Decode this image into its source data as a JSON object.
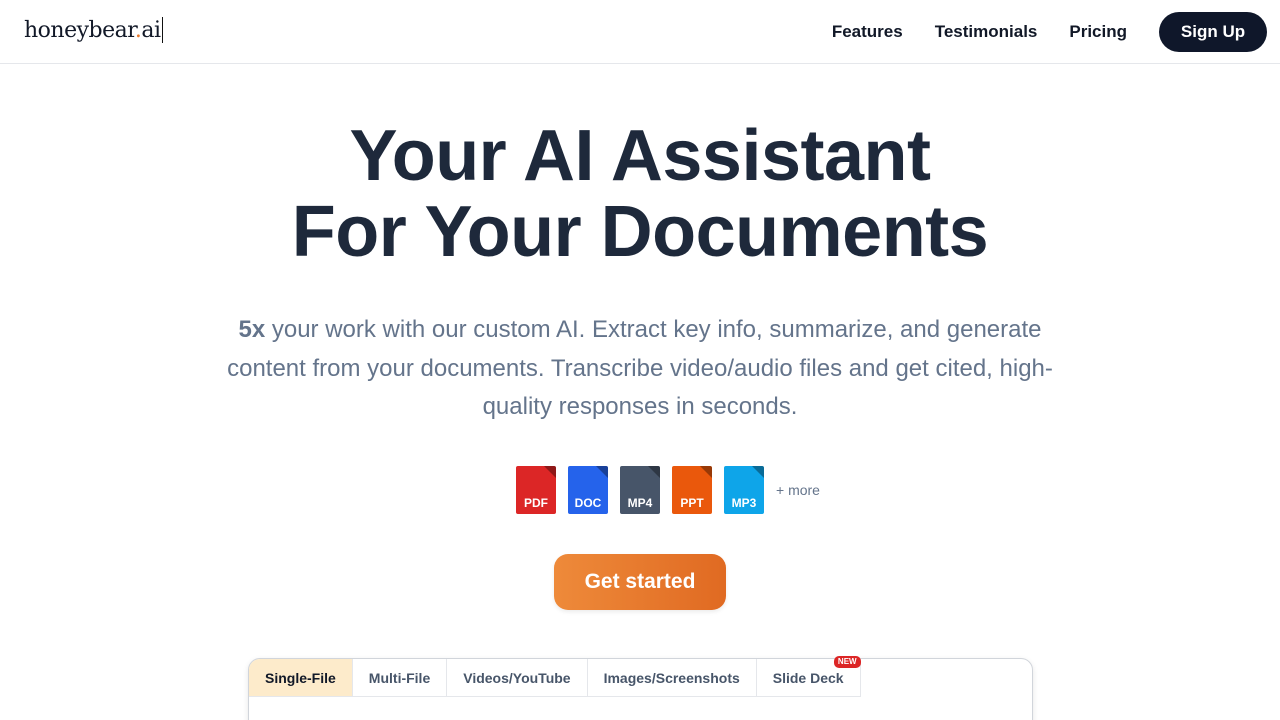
{
  "header": {
    "logo": {
      "name": "honeybear",
      "dot": ".",
      "suffix": "ai"
    },
    "nav": [
      "Features",
      "Testimonials",
      "Pricing"
    ],
    "signup_label": "Sign Up"
  },
  "hero": {
    "title_line1": "Your AI Assistant",
    "title_line2": "For Your Documents",
    "subtitle_bold": "5x",
    "subtitle_rest": " your work with our custom AI. Extract key info, summarize, and generate content from your documents. Transcribe video/audio files and get cited, high-quality responses in seconds.",
    "file_types": [
      {
        "label": "PDF",
        "color": "#dc2626"
      },
      {
        "label": "DOC",
        "color": "#2563eb"
      },
      {
        "label": "MP4",
        "color": "#475569"
      },
      {
        "label": "PPT",
        "color": "#ea580c"
      },
      {
        "label": "MP3",
        "color": "#0ea5e9"
      }
    ],
    "more_label": "+ more",
    "cta_label": "Get started"
  },
  "demo": {
    "tabs": [
      "Single-File",
      "Multi-File",
      "Videos/YouTube",
      "Images/Screenshots",
      "Slide Deck"
    ],
    "active_tab": "Single-File",
    "new_badge": "NEW"
  },
  "colors": {
    "accent": "#ea7a2c",
    "dark": "#0f172a",
    "active_tab_bg": "#fdebcb"
  }
}
